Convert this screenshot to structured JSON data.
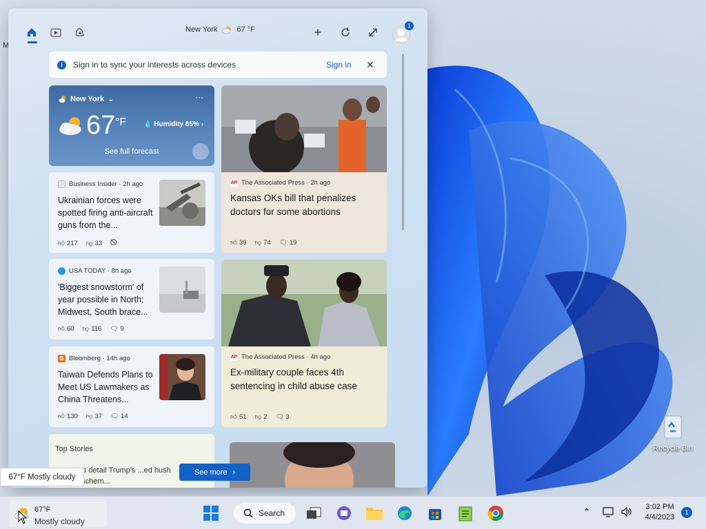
{
  "widgets": {
    "location": "New York",
    "location_temp": "67 °F",
    "signin_message": "Sign in to sync your interests across devices",
    "signin_link": "Sign in",
    "avatar_badge": "1"
  },
  "weather_card": {
    "city": "New York",
    "temp": "67",
    "unit": "°F",
    "humidity": "Humidity 85%",
    "forecast_link": "See full forecast"
  },
  "news": [
    {
      "source": "Business Insider · 2h ago",
      "headline": "Ukrainian forces were spotted firing anti-aircraft guns from the...",
      "likes": "217",
      "dislikes": "33"
    },
    {
      "source": "The Associated Press · 2h ago",
      "headline": "Kansas OKs bill that penalizes doctors for some abortions",
      "likes": "39",
      "dislikes": "74",
      "comments": "19"
    },
    {
      "source": "USA TODAY · 8h ago",
      "headline": "'Biggest snowstorm' of year possible in North; Midwest, South brace...",
      "likes": "60",
      "dislikes": "116",
      "comments": "9"
    },
    {
      "source": "The Associated Press · 4h ago",
      "headline": "Ex-military couple faces 4th sentencing in child abuse case",
      "likes": "51",
      "dislikes": "2",
      "comments": "3"
    },
    {
      "source": "Bloomberg · 14h ago",
      "headline": "Taiwan Defends Plans to Meet US Lawmakers as China Threatens...",
      "likes": "130",
      "dislikes": "37",
      "comments": "14"
    }
  ],
  "top_stories": {
    "title": "Top Stories",
    "snippet": "...ecutors detail Trump's ...ed hush money 'schem...",
    "see_more": "See more"
  },
  "tooltip": "67°F Mostly cloudy",
  "taskbar": {
    "weather_temp": "67°F",
    "weather_desc": "Mostly cloudy",
    "search_label": "Search",
    "time": "3:02 PM",
    "date": "4/4/2023",
    "notification_count": "1"
  },
  "desktop": {
    "recycle_bin": "Recycle Bin"
  },
  "colors": {
    "accent": "#1161c7",
    "weather_card": "#4a76ae",
    "panel": "#d3e2f2"
  }
}
